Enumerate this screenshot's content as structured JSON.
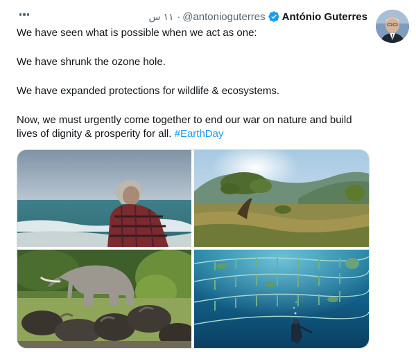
{
  "tweet": {
    "author_name": "António Guterres",
    "handle": "@antonioguterres",
    "separator": "·",
    "time": "١١ س",
    "text": {
      "line1": "We have seen what is possible when we act as one:",
      "line2": "We have shrunk the ozone hole.",
      "line3": "We have expanded protections for wildlife & ecosystems.",
      "line4": "Now, we must urgently come together to end our war on nature and build lives of dignity & prosperity for all.",
      "hashtag": "#EarthDay"
    }
  },
  "media": [
    {
      "subject": "man-at-seashore"
    },
    {
      "subject": "savanna-tree-hills"
    },
    {
      "subject": "elephant-and-buffalo-herd"
    },
    {
      "subject": "underwater-diver-kelp-lines"
    }
  ],
  "icons": {
    "more": "more-horizontal-icon",
    "verified": "verified-badge-icon"
  },
  "colors": {
    "accent": "#1d9bf0",
    "text": "#0f1419",
    "secondary": "#536471"
  }
}
